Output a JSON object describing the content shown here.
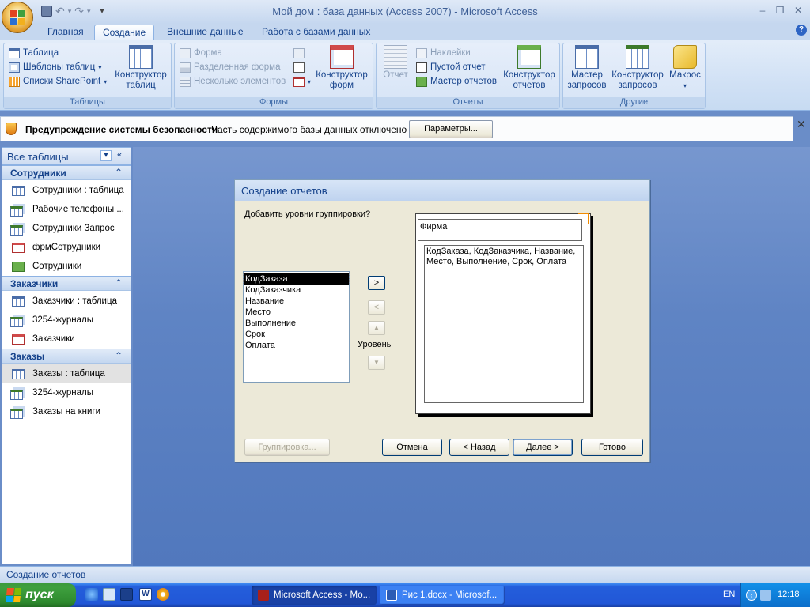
{
  "window": {
    "title": "Мой дом : база данных (Access 2007) - Microsoft Access",
    "controls": {
      "minimize": "–",
      "restore": "❐",
      "close": "✕"
    }
  },
  "ribbon": {
    "tabs": [
      "Главная",
      "Создание",
      "Внешние данные",
      "Работа с базами данных"
    ],
    "active_tab": "Создание",
    "help_icon": "?",
    "groups": {
      "tables": {
        "label": "Таблицы",
        "table": "Таблица",
        "templates": "Шаблоны таблиц",
        "sharepoint": "Списки SharePoint",
        "designer_line1": "Конструктор",
        "designer_line2": "таблиц"
      },
      "forms": {
        "label": "Формы",
        "form": "Форма",
        "split_form": "Разделенная форма",
        "multiple_items": "Несколько элементов",
        "designer_line1": "Конструктор",
        "designer_line2": "форм"
      },
      "reports": {
        "label": "Отчеты",
        "report": "Отчет",
        "labels": "Наклейки",
        "blank_report": "Пустой отчет",
        "report_wizard": "Мастер отчетов",
        "designer_line1": "Конструктор",
        "designer_line2": "отчетов"
      },
      "other": {
        "label": "Другие",
        "query_wizard_line1": "Мастер",
        "query_wizard_line2": "запросов",
        "query_designer_line1": "Конструктор",
        "query_designer_line2": "запросов",
        "macro": "Макрос"
      }
    }
  },
  "security_bar": {
    "title": "Предупреждение системы безопасности",
    "message": "Часть содержимого базы данных отключено",
    "button": "Параметры...",
    "close": "✕"
  },
  "nav_pane": {
    "header": "Все таблицы",
    "groups": [
      {
        "name": "Сотрудники",
        "items": [
          {
            "label": "Сотрудники : таблица",
            "icon": "table-icon"
          },
          {
            "label": "Рабочие телефоны ...",
            "icon": "query-icon"
          },
          {
            "label": "Сотрудники Запрос",
            "icon": "query-icon"
          },
          {
            "label": "фрмСотрудники",
            "icon": "form-icon"
          },
          {
            "label": "Сотрудники",
            "icon": "report-icon"
          }
        ]
      },
      {
        "name": "Заказчики",
        "items": [
          {
            "label": "Заказчики : таблица",
            "icon": "table-icon"
          },
          {
            "label": "3254-журналы",
            "icon": "query-icon"
          },
          {
            "label": "Заказчики",
            "icon": "form-icon"
          }
        ]
      },
      {
        "name": "Заказы",
        "items": [
          {
            "label": "Заказы : таблица",
            "icon": "table-icon",
            "selected": true
          },
          {
            "label": "3254-журналы",
            "icon": "query-icon"
          },
          {
            "label": "Заказы на книги",
            "icon": "query-icon"
          }
        ]
      }
    ]
  },
  "dialog": {
    "title": "Создание отчетов",
    "prompt": "Добавить уровни группировки?",
    "fields": [
      "КодЗаказа",
      "КодЗаказчика",
      "Название",
      "Место",
      "Выполнение",
      "Срок",
      "Оплата"
    ],
    "selected_field": "КодЗаказа",
    "add_button": ">",
    "remove_button": "<",
    "level_label": "Уровень",
    "preview_group": "Фирма",
    "preview_fields_line1": "КодЗаказа, КодЗаказчика, Название,",
    "preview_fields_line2": "Место, Выполнение, Срок, Оплата",
    "grouping_button": "Группировка...",
    "cancel_button": "Отмена",
    "back_button": "< Назад",
    "next_button": "Далее >",
    "finish_button": "Готово"
  },
  "status_bar": {
    "text": "Создание отчетов"
  },
  "taskbar": {
    "start": "пуск",
    "tasks": [
      {
        "label": "Microsoft Access - Мо...",
        "active": true
      },
      {
        "label": "Рис 1.docx - Microsof...",
        "active": false
      }
    ],
    "language": "EN",
    "clock": "12:18"
  },
  "colors": {
    "ribbon_text": "#15428b",
    "workspace": "#6a8dc8",
    "taskbar": "#245edb",
    "start_button": "#3c9a3c"
  }
}
